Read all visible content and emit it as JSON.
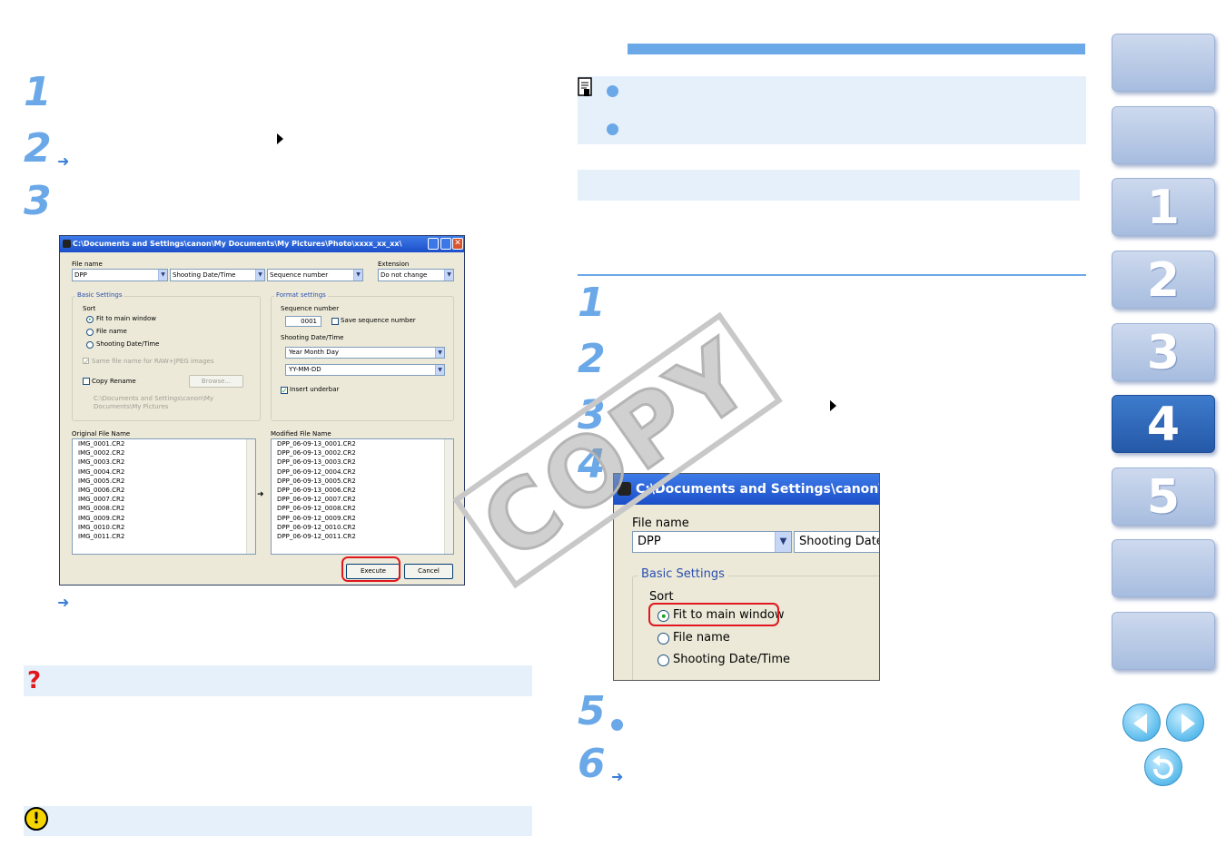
{
  "left": {
    "steps": [
      "1",
      "2",
      "3"
    ],
    "arrow": "➜",
    "dialog": {
      "title": "C:\\Documents and Settings\\canon\\My Documents\\My Pictures\\Photo\\xxxx_xx_xx\\",
      "file_name_label": "File name",
      "file_name_combos": [
        "DPP",
        "Shooting Date/Time",
        "Sequence number"
      ],
      "extension_label": "Extension",
      "extension_value": "Do not change",
      "basic_settings": "Basic Settings",
      "sort": "Sort",
      "sort_options": [
        "Fit to main window",
        "File name",
        "Shooting Date/Time"
      ],
      "same_file_name": "Same file name for RAW+JPEG images",
      "copy_rename": "Copy Rename",
      "browse": "Browse...",
      "path": "C:\\Documents and Settings\\canon\\My Documents\\My Pictures",
      "format_settings": "Format settings",
      "sequence_number_label": "Sequence number",
      "sequence_number_value": "0001",
      "save_sequence_number": "Save sequence number",
      "shooting_datetime_label": "Shooting Date/Time",
      "date_format": "Year Month Day",
      "date_pattern": "YY-MM-DD",
      "insert_underbar": "Insert underbar",
      "original_file_name": "Original File Name",
      "modified_file_name": "Modified File Name",
      "original_files": [
        "IMG_0001.CR2",
        "IMG_0002.CR2",
        "IMG_0003.CR2",
        "IMG_0004.CR2",
        "IMG_0005.CR2",
        "IMG_0006.CR2",
        "IMG_0007.CR2",
        "IMG_0008.CR2",
        "IMG_0009.CR2",
        "IMG_0010.CR2",
        "IMG_0011.CR2"
      ],
      "modified_files": [
        "DPP_06-09-13_0001.CR2",
        "DPP_06-09-13_0002.CR2",
        "DPP_06-09-13_0003.CR2",
        "DPP_06-09-12_0004.CR2",
        "DPP_06-09-13_0005.CR2",
        "DPP_06-09-13_0006.CR2",
        "DPP_06-09-12_0007.CR2",
        "DPP_06-09-12_0008.CR2",
        "DPP_06-09-12_0009.CR2",
        "DPP_06-09-12_0010.CR2",
        "DPP_06-09-12_0011.CR2"
      ],
      "execute": "Execute",
      "cancel": "Cancel"
    },
    "question_icon": "?",
    "warning_icon": "!"
  },
  "right": {
    "steps": [
      "1",
      "2",
      "3",
      "4",
      "5",
      "6"
    ],
    "arrow": "➜",
    "zoom": {
      "title": "C:\\Documents and Settings\\canon\\My Documents",
      "file_name_label": "File name",
      "combo1": "DPP",
      "combo2": "Shooting Date/Time",
      "basic_settings": "Basic Settings",
      "sort": "Sort",
      "sort_options": [
        "Fit to main window",
        "File name",
        "Shooting Date/Time"
      ]
    }
  },
  "watermark": "COPY",
  "tabs": [
    "",
    "",
    "1",
    "2",
    "3",
    "4",
    "5",
    ""
  ],
  "active_tab": "4",
  "colors": {
    "accent": "#6aa8e8",
    "panel": "#e6f0fb",
    "tab_active": "#2e65b8",
    "highlight": "#e0171f"
  }
}
